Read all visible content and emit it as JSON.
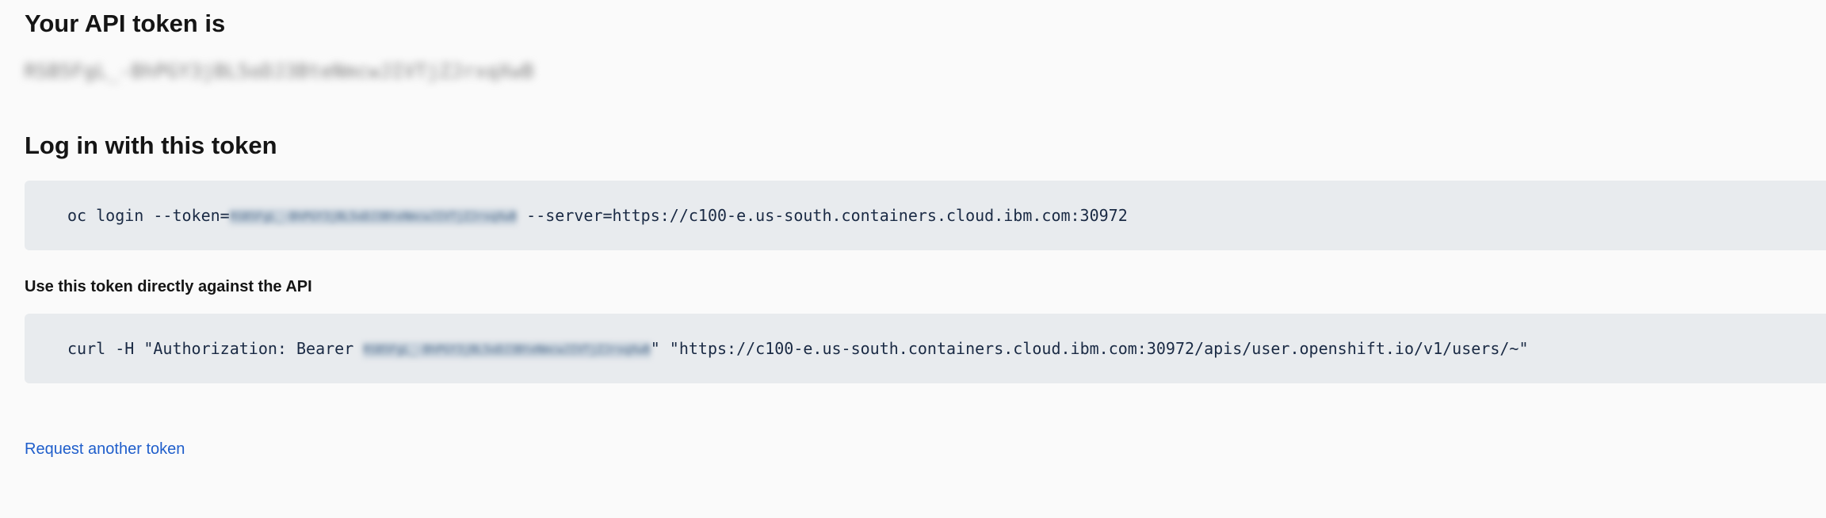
{
  "heading": "Your API token is",
  "token_masked": "RSB5FgL_-BhPGY3jBL5oDJ3BteNmcwJIVTjZJrxqXwB",
  "login_heading": "Log in with this token",
  "login_command": {
    "prefix": "oc login --token=",
    "token": "RSB5FgL_-BhPGY3jBL5oDJ3BteNmcwJIVTjZJrxqXwB",
    "suffix": " --server=https://c100-e.us-south.containers.cloud.ibm.com:30972"
  },
  "api_heading": "Use this token directly against the API",
  "curl_command": {
    "prefix": "curl -H \"Authorization: Bearer ",
    "token": "RSB5FgL_-BhPGY3jBL5oDJ3BteNmcwJIVTjZJrxqXwB",
    "suffix": "\" \"https://c100-e.us-south.containers.cloud.ibm.com:30972/apis/user.openshift.io/v1/users/~\""
  },
  "request_link": "Request another token"
}
